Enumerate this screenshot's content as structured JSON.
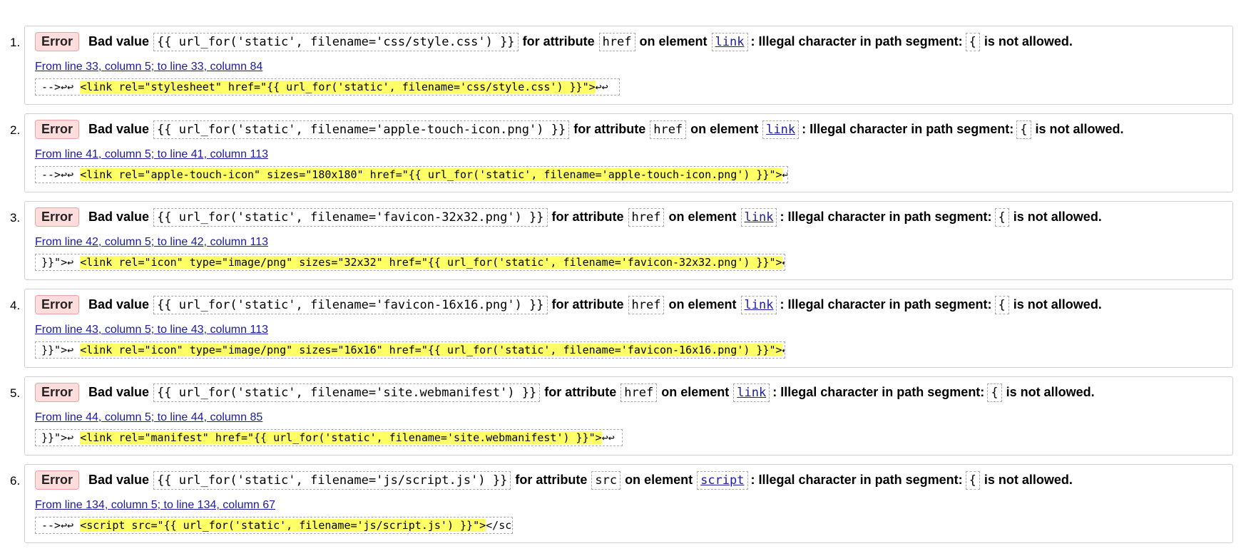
{
  "errors": [
    {
      "num": "1.",
      "label": "Error",
      "bad_value_label": "Bad value",
      "value": "{{ url_for('static', filename='css/style.css') }}",
      "for_attr_label": "for attribute",
      "attribute": "href",
      "on_element_label": "on element",
      "element": "link",
      "illegal_label": ": Illegal character in path segment:",
      "char": "{",
      "not_allowed_label": "is not allowed.",
      "location": "From line 33, column 5; to line 33, column 84",
      "extract_before": "-->↩↩    ",
      "extract_highlight": "<link rel=\"stylesheet\" href=\"{{ url_for('static', filename='css/style.css') }}\">",
      "extract_after": "↩↩"
    },
    {
      "num": "2.",
      "label": "Error",
      "bad_value_label": "Bad value",
      "value": "{{ url_for('static', filename='apple-touch-icon.png') }}",
      "for_attr_label": "for attribute",
      "attribute": "href",
      "on_element_label": "on element",
      "element": "link",
      "illegal_label": ": Illegal character in path segment:",
      "char": "{",
      "not_allowed_label": "is not allowed.",
      "location": "From line 41, column 5; to line 41, column 113",
      "extract_before": "-->↩↩    ",
      "extract_highlight": "<link rel=\"apple-touch-icon\" sizes=\"180x180\" href=\"{{ url_for('static', filename='apple-touch-icon.png') }}\">",
      "extract_after": "↩    <"
    },
    {
      "num": "3.",
      "label": "Error",
      "bad_value_label": "Bad value",
      "value": "{{ url_for('static', filename='favicon-32x32.png') }}",
      "for_attr_label": "for attribute",
      "attribute": "href",
      "on_element_label": "on element",
      "element": "link",
      "illegal_label": ": Illegal character in path segment:",
      "char": "{",
      "not_allowed_label": "is not allowed.",
      "location": "From line 42, column 5; to line 42, column 113",
      "extract_before": "}}\">↩    ",
      "extract_highlight": "<link rel=\"icon\" type=\"image/png\" sizes=\"32x32\" href=\"{{ url_for('static', filename='favicon-32x32.png') }}\">",
      "extract_after": "↩    <"
    },
    {
      "num": "4.",
      "label": "Error",
      "bad_value_label": "Bad value",
      "value": "{{ url_for('static', filename='favicon-16x16.png') }}",
      "for_attr_label": "for attribute",
      "attribute": "href",
      "on_element_label": "on element",
      "element": "link",
      "illegal_label": ": Illegal character in path segment:",
      "char": "{",
      "not_allowed_label": "is not allowed.",
      "location": "From line 43, column 5; to line 43, column 113",
      "extract_before": "}}\">↩    ",
      "extract_highlight": "<link rel=\"icon\" type=\"image/png\" sizes=\"16x16\" href=\"{{ url_for('static', filename='favicon-16x16.png') }}\">",
      "extract_after": "↩    <"
    },
    {
      "num": "5.",
      "label": "Error",
      "bad_value_label": "Bad value",
      "value": "{{ url_for('static', filename='site.webmanifest') }}",
      "for_attr_label": "for attribute",
      "attribute": "href",
      "on_element_label": "on element",
      "element": "link",
      "illegal_label": ": Illegal character in path segment:",
      "char": "{",
      "not_allowed_label": "is not allowed.",
      "location": "From line 44, column 5; to line 44, column 85",
      "extract_before": "}}\">↩    ",
      "extract_highlight": "<link rel=\"manifest\" href=\"{{ url_for('static', filename='site.webmanifest') }}\">",
      "extract_after": "↩↩"
    },
    {
      "num": "6.",
      "label": "Error",
      "bad_value_label": "Bad value",
      "value": "{{ url_for('static', filename='js/script.js') }}",
      "for_attr_label": "for attribute",
      "attribute": "src",
      "on_element_label": "on element",
      "element": "script",
      "illegal_label": ": Illegal character in path segment:",
      "char": "{",
      "not_allowed_label": "is not allowed.",
      "location": "From line 134, column 5; to line 134, column 67",
      "extract_before": "-->↩↩    ",
      "extract_highlight": "<script src=\"{{ url_for('static', filename='js/script.js') }}\">",
      "extract_after": "</scri"
    }
  ]
}
